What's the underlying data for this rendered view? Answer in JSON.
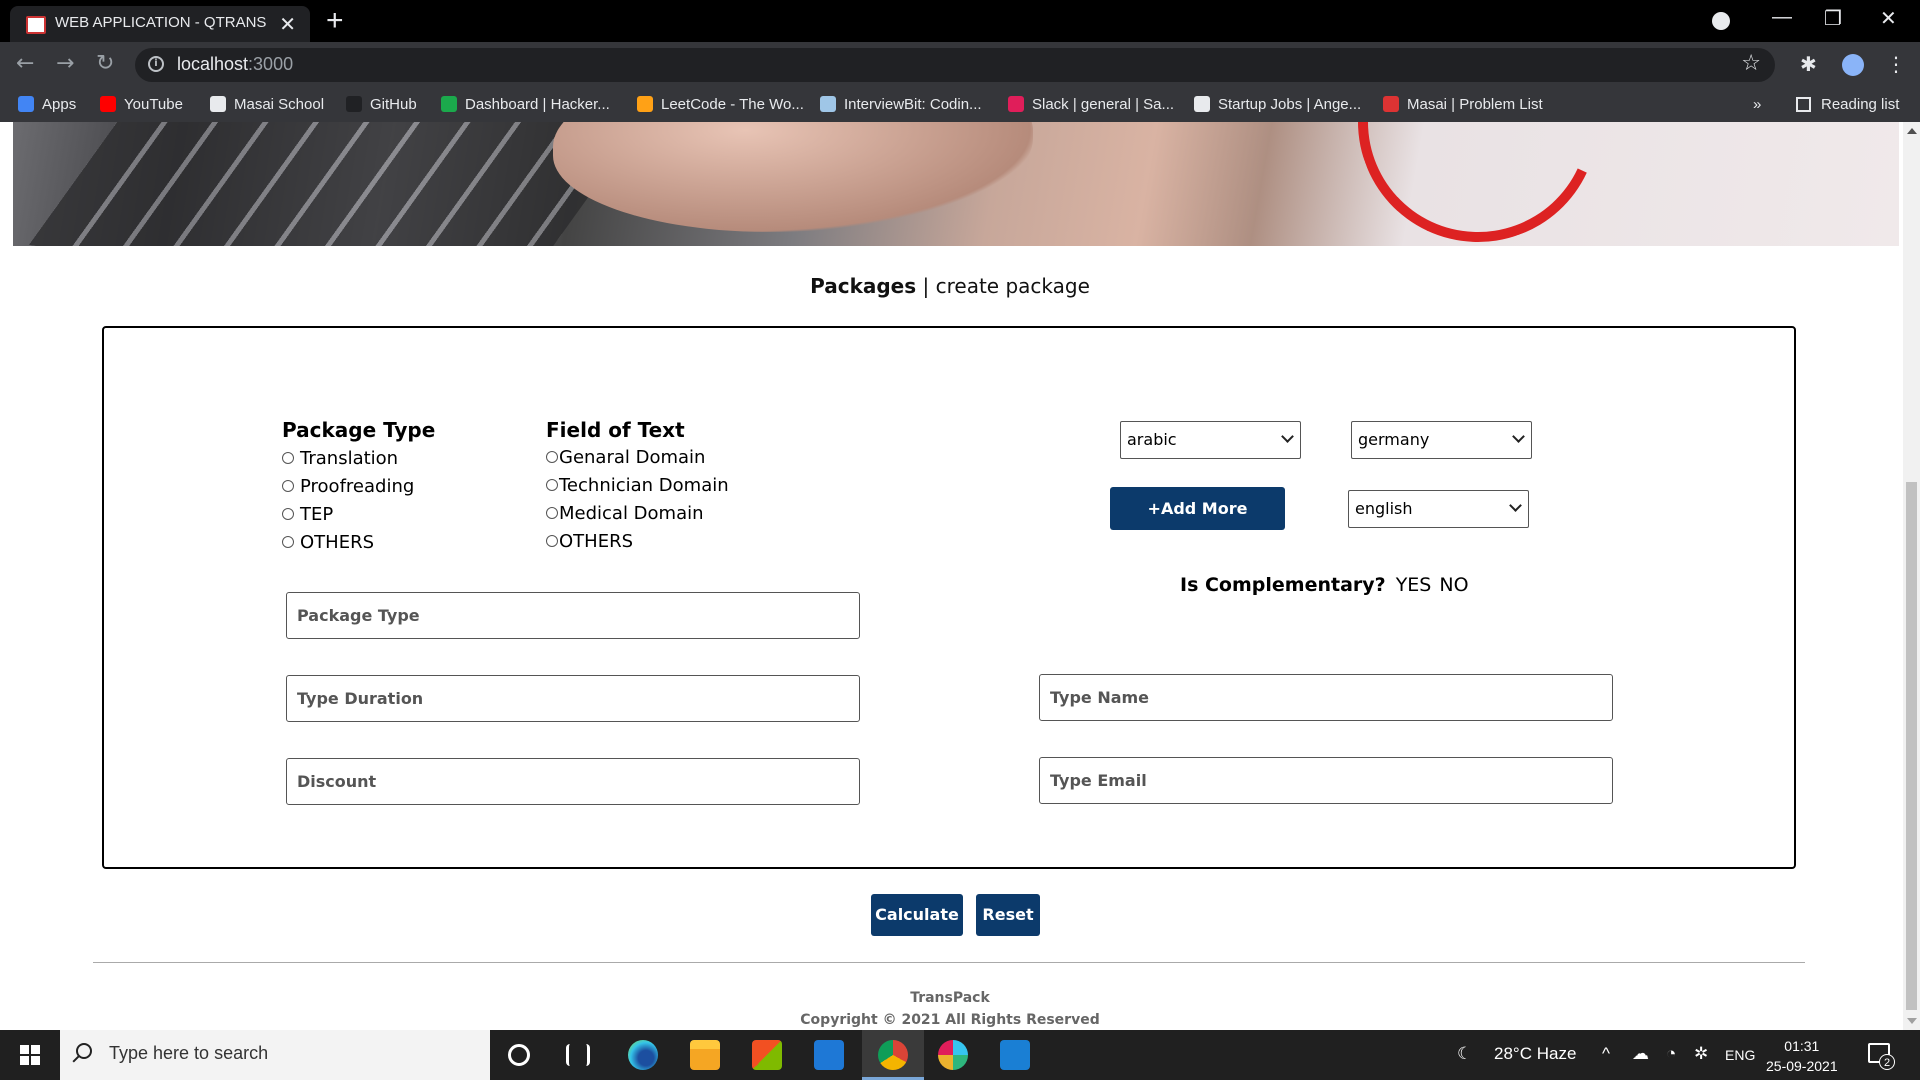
{
  "browser": {
    "tab_title": "WEB APPLICATION - QTRANS",
    "new_tab": "+",
    "url_host": "localhost",
    "url_port": ":3000",
    "bookmarks": [
      {
        "label": "Apps",
        "icon": "apps-grid-icon",
        "color": "#4285f4"
      },
      {
        "label": "YouTube",
        "icon": "youtube-icon",
        "color": "#ff0000"
      },
      {
        "label": "Masai School",
        "icon": "masai-school-icon",
        "color": "#e8eaed"
      },
      {
        "label": "GitHub",
        "icon": "github-icon",
        "color": "#202124"
      },
      {
        "label": "Dashboard | Hacker...",
        "icon": "hackerrank-icon",
        "color": "#1ba94c"
      },
      {
        "label": "LeetCode - The Wo...",
        "icon": "leetcode-icon",
        "color": "#ffa116"
      },
      {
        "label": "InterviewBit: Codin...",
        "icon": "interviewbit-icon",
        "color": "#9fc6e7"
      },
      {
        "label": "Slack | general | Sa...",
        "icon": "slack-icon",
        "color": "#e01e5a"
      },
      {
        "label": "Startup Jobs | Ange...",
        "icon": "angellist-icon",
        "color": "#e8eaed"
      },
      {
        "label": "Masai | Problem List",
        "icon": "masai-problem-icon",
        "color": "#d33"
      }
    ],
    "bookmarks_overflow": "»",
    "reading_list": "Reading list"
  },
  "page": {
    "breadcrumb_bold": "Packages",
    "breadcrumb_sep": "|",
    "breadcrumb_rest": "create package",
    "package_type": {
      "title": "Package Type",
      "options": [
        "Translation",
        "Proofreading",
        "TEP",
        "OTHERS"
      ]
    },
    "field_of_text": {
      "title": "Field of Text",
      "options": [
        "Genaral Domain",
        "Technician Domain",
        "Medical Domain",
        "OTHERS"
      ]
    },
    "language_from": "arabic",
    "language_to": "germany",
    "language_to_2": "english",
    "add_more": "+Add More",
    "complementary": {
      "label": "Is Complementary?",
      "yes": "YES",
      "no": "NO"
    },
    "inputs": {
      "package_type_ph": "Package Type",
      "duration_ph": "Type Duration",
      "discount_ph": "Discount",
      "name_ph": "Type Name",
      "email_ph": "Type Email"
    },
    "calculate": "Calculate",
    "reset": "Reset",
    "footer_line1": "TransPack",
    "footer_line2": "Copyright © 2021 All Rights Reserved",
    "accent_color": "#0c3a6b"
  },
  "taskbar": {
    "search_placeholder": "Type here to search",
    "weather": "28°C  Haze",
    "lang": "ENG",
    "time": "01:31",
    "date": "25-09-2021",
    "notifications": "2"
  }
}
